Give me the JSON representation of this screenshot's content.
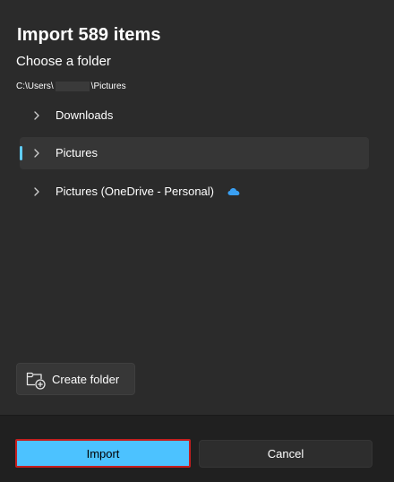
{
  "dialog": {
    "title": "Import 589 items",
    "subtitle": "Choose a folder",
    "path_prefix": "C:\\Users\\",
    "path_suffix": "\\Pictures"
  },
  "tree": {
    "items": [
      {
        "label": "Downloads",
        "selected": false
      },
      {
        "label": "Pictures",
        "selected": true
      },
      {
        "label": "Pictures (OneDrive - Personal)",
        "selected": false,
        "icon": "onedrive-cloud-icon"
      }
    ]
  },
  "actions": {
    "create_folder_label": "Create folder",
    "import_label": "Import",
    "cancel_label": "Cancel"
  },
  "colors": {
    "background": "#2b2b2b",
    "footer": "#202020",
    "accent": "#4cc2ff",
    "highlight_border": "#c41e1e",
    "selection_indicator": "#60cdff"
  }
}
